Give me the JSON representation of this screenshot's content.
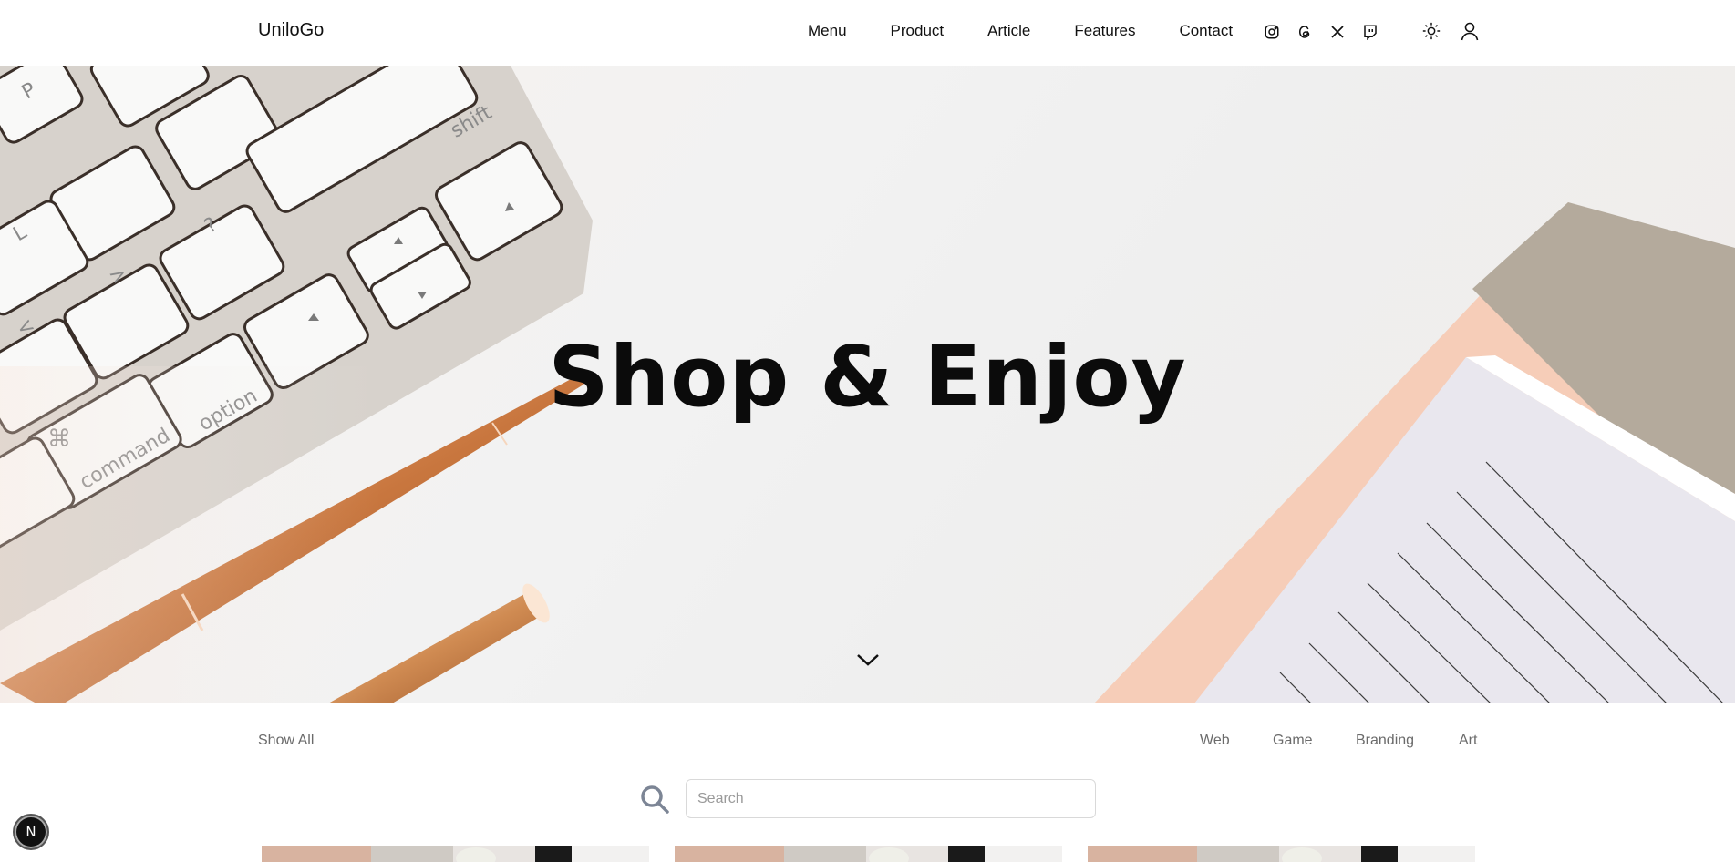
{
  "brand": {
    "logo": "UniloGo"
  },
  "nav": {
    "items": [
      "Menu",
      "Product",
      "Article",
      "Features",
      "Contact"
    ]
  },
  "social": {
    "icons": [
      "instagram-icon",
      "threads-icon",
      "x-icon",
      "twitch-icon"
    ]
  },
  "utility": {
    "icons": [
      "sun-icon",
      "user-icon"
    ]
  },
  "hero": {
    "title": "Shop & Enjoy"
  },
  "filters": {
    "show_all": "Show All",
    "categories": [
      "Web",
      "Game",
      "Branding",
      "Art"
    ]
  },
  "search": {
    "placeholder": "Search",
    "value": ""
  },
  "dev_badge": {
    "label": "N"
  },
  "colors": {
    "text": "#111111",
    "muted": "#6b6b6b",
    "pen_gold": "#d48a5a",
    "paper_pink": "#f6cdb8"
  }
}
